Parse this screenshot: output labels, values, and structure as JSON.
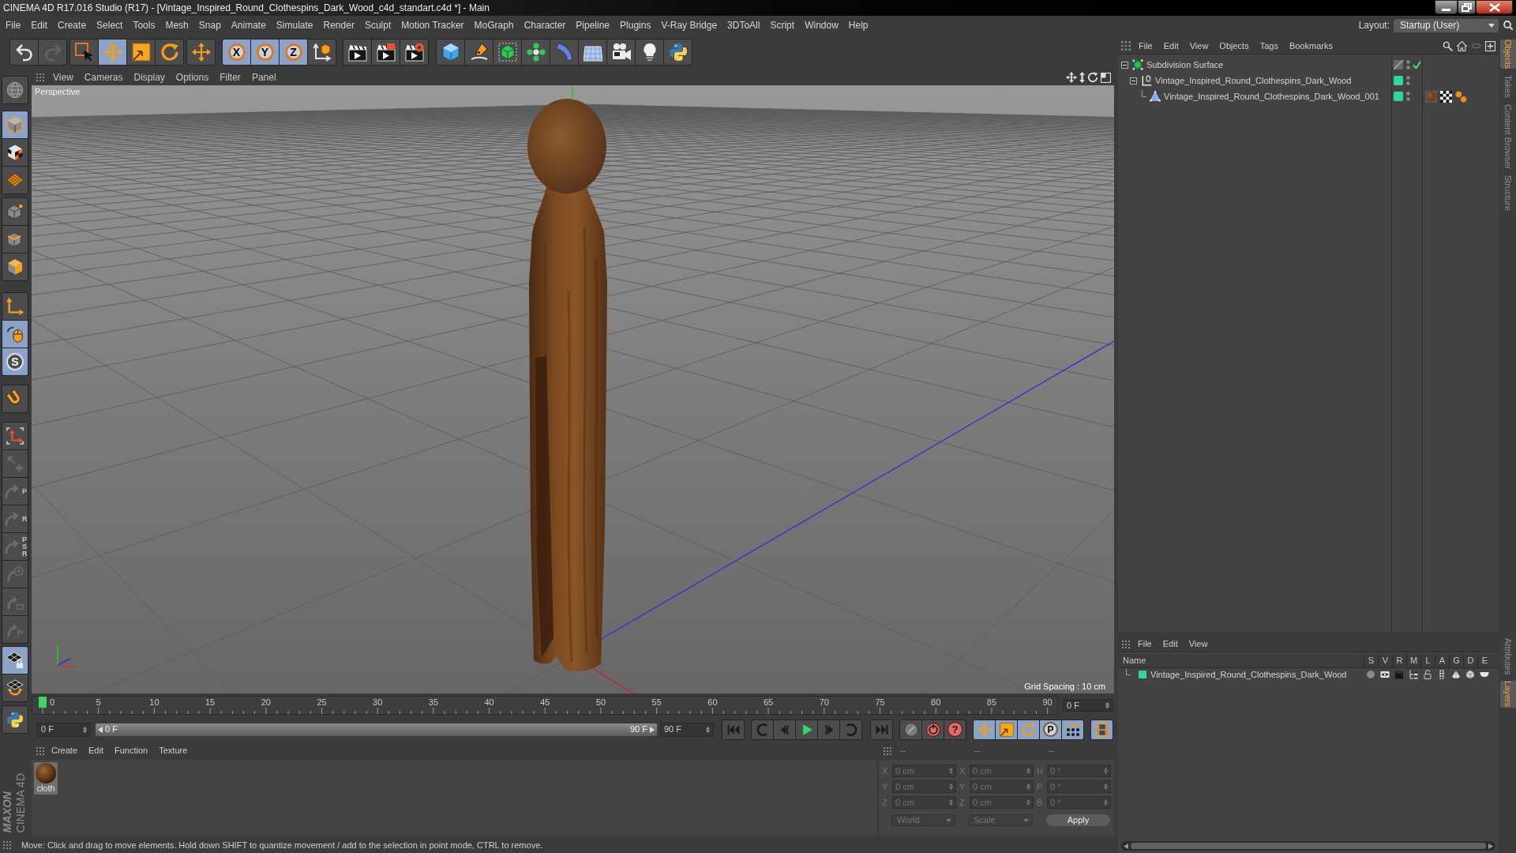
{
  "window": {
    "title": "CINEMA 4D R17.016 Studio (R17) - [Vintage_Inspired_Round_Clothespins_Dark_Wood_c4d_standart.c4d *] - Main"
  },
  "menu_bar": [
    "File",
    "Edit",
    "Create",
    "Select",
    "Tools",
    "Mesh",
    "Snap",
    "Animate",
    "Simulate",
    "Render",
    "Sculpt",
    "Motion Tracker",
    "MoGraph",
    "Character",
    "Pipeline",
    "Plugins",
    "V-Ray Bridge",
    "3DToAll",
    "Script",
    "Window",
    "Help"
  ],
  "layout": {
    "label": "Layout:",
    "value": "Startup (User)"
  },
  "toolbar": [
    {
      "selected": false,
      "disabled": false
    },
    {
      "selected": false,
      "disabled": true
    },
    {
      "selected": false,
      "disabled": false
    },
    {
      "selected": true,
      "disabled": false
    },
    {
      "selected": false,
      "disabled": false
    },
    {
      "selected": false,
      "disabled": false
    },
    {
      "selected": false,
      "disabled": false
    },
    {
      "selected": true,
      "disabled": false,
      "label": "X"
    },
    {
      "selected": true,
      "disabled": false,
      "label": "Y"
    },
    {
      "selected": true,
      "disabled": false,
      "label": "Z"
    },
    {
      "selected": false,
      "disabled": false
    },
    {
      "selected": false,
      "disabled": false
    },
    {
      "selected": false,
      "disabled": false
    },
    {
      "selected": false,
      "disabled": false
    },
    {
      "selected": false,
      "disabled": false
    },
    {
      "selected": false,
      "disabled": false
    },
    {
      "selected": false,
      "disabled": false
    },
    {
      "selected": false,
      "disabled": false
    },
    {
      "selected": false,
      "disabled": false
    },
    {
      "selected": false,
      "disabled": false
    },
    {
      "selected": false,
      "disabled": false
    },
    {
      "selected": false,
      "disabled": false
    },
    {
      "selected": false,
      "disabled": false
    }
  ],
  "tool_palette": [
    {
      "selected": false,
      "disabled": false
    },
    {
      "selected": true,
      "disabled": false
    },
    {
      "selected": false,
      "disabled": false
    },
    {
      "selected": false,
      "disabled": false
    },
    {
      "selected": false,
      "disabled": false
    },
    {
      "selected": false,
      "disabled": false
    },
    {
      "selected": false,
      "disabled": false
    },
    {
      "selected": false,
      "disabled": false
    },
    {
      "selected": true,
      "disabled": false
    },
    {
      "selected": true,
      "disabled": false,
      "label": "S"
    },
    {
      "selected": false,
      "disabled": false
    },
    {
      "selected": false,
      "disabled": false
    },
    {
      "selected": false,
      "disabled": true
    },
    {
      "selected": false,
      "disabled": true,
      "label": "P"
    },
    {
      "selected": false,
      "disabled": true,
      "label": "R"
    },
    {
      "selected": false,
      "disabled": true,
      "label": "PSR"
    },
    {
      "selected": false,
      "disabled": true
    },
    {
      "selected": false,
      "disabled": true
    },
    {
      "selected": false,
      "disabled": true
    },
    {
      "selected": true,
      "disabled": false
    },
    {
      "selected": false,
      "disabled": false
    },
    {
      "selected": false,
      "disabled": false
    }
  ],
  "viewport": {
    "menu": [
      "View",
      "Cameras",
      "Display",
      "Options",
      "Filter",
      "Panel"
    ],
    "camera": "Perspective",
    "grid_spacing": "Grid Spacing : 10 cm"
  },
  "timeline": {
    "frame_labels": [
      "0",
      "5",
      "10",
      "15",
      "20",
      "25",
      "30",
      "35",
      "40",
      "45",
      "50",
      "55",
      "60",
      "65",
      "70",
      "75",
      "80",
      "85",
      "90"
    ],
    "level": 0,
    "current_frame": "0 F"
  },
  "playback": {
    "start_frame": "0 F",
    "preview_range": {
      "start": "0 F",
      "end": "90 F"
    },
    "end_frame": "90 F",
    "buttons": [
      {
        "selected": false
      },
      {
        "selected": false
      },
      {
        "selected": false
      },
      {
        "selected": false
      },
      {
        "selected": false
      },
      {
        "selected": false
      },
      {
        "selected": false
      },
      {
        "selected": false
      },
      {
        "selected": false
      },
      {
        "selected": false,
        "label": "?"
      },
      {
        "selected": true
      },
      {
        "selected": true
      },
      {
        "selected": true
      },
      {
        "selected": true,
        "label": "P"
      },
      {
        "selected": true
      },
      {
        "selected": true
      }
    ]
  },
  "material_manager": {
    "menu": [
      "Create",
      "Edit",
      "Function",
      "Texture"
    ],
    "materials": [
      {
        "name": "cloth",
        "selected": true
      }
    ]
  },
  "coordinates": {
    "disabled": true,
    "headers": [
      "--",
      "--",
      "--"
    ],
    "rows": [
      {
        "position_axis": "X",
        "position": "0 cm",
        "size_axis": "X",
        "size": "0 cm",
        "rotation_axis": "H",
        "rotation": "0 °"
      },
      {
        "position_axis": "Y",
        "position": "0 cm",
        "size_axis": "Y",
        "size": "0 cm",
        "rotation_axis": "P",
        "rotation": "0 °"
      },
      {
        "position_axis": "Z",
        "position": "0 cm",
        "size_axis": "Z",
        "size": "0 cm",
        "rotation_axis": "B",
        "rotation": "0 °"
      }
    ],
    "coordinate_system": "World",
    "size_mode": "Scale",
    "apply": "Apply"
  },
  "logo": {
    "brand": "MAXON",
    "product": "CINEMA 4D"
  },
  "status_bar": "Move: Click and drag to move elements. Hold down SHIFT to quantize movement / add to the selection in point mode, CTRL to remove.",
  "object_manager": {
    "menu": [
      "File",
      "Edit",
      "View",
      "Objects",
      "Tags",
      "Bookmarks"
    ],
    "objects": [
      {
        "kind": "subdivision",
        "name": "Subdivision Surface",
        "expanded": true,
        "enabled": true,
        "children": [
          {
            "kind": "null",
            "name": "Vintage_Inspired_Round_Clothespins_Dark_Wood",
            "color": "#33d69a",
            "expanded": true,
            "children": [
              {
                "kind": "polygon",
                "name": "Vintage_Inspired_Round_Clothespins_Dark_Wood_001",
                "color": "#33d69a",
                "expanded": false,
                "tags": [
                  {
                    "kind": "material"
                  },
                  {
                    "kind": "uvw"
                  },
                  {
                    "kind": "phong"
                  }
                ]
              }
            ]
          }
        ]
      }
    ]
  },
  "layer_manager": {
    "menu": [
      "File",
      "Edit",
      "View"
    ],
    "columns": [
      "Name",
      "S",
      "V",
      "R",
      "M",
      "L",
      "A",
      "G",
      "D",
      "E"
    ],
    "layers": [
      {
        "name": "Vintage_Inspired_Round_Clothespins_Dark_Wood",
        "color": "#33d69a"
      }
    ]
  },
  "side_tabs_top": [
    {
      "label": "Objects",
      "selected": true
    },
    {
      "label": "Takes",
      "selected": false
    },
    {
      "label": "Content Browser",
      "selected": false
    },
    {
      "label": "Structure",
      "selected": false
    }
  ],
  "side_tabs_bottom": [
    {
      "label": "Attributes",
      "selected": false
    },
    {
      "label": "Layers",
      "selected": true
    }
  ]
}
